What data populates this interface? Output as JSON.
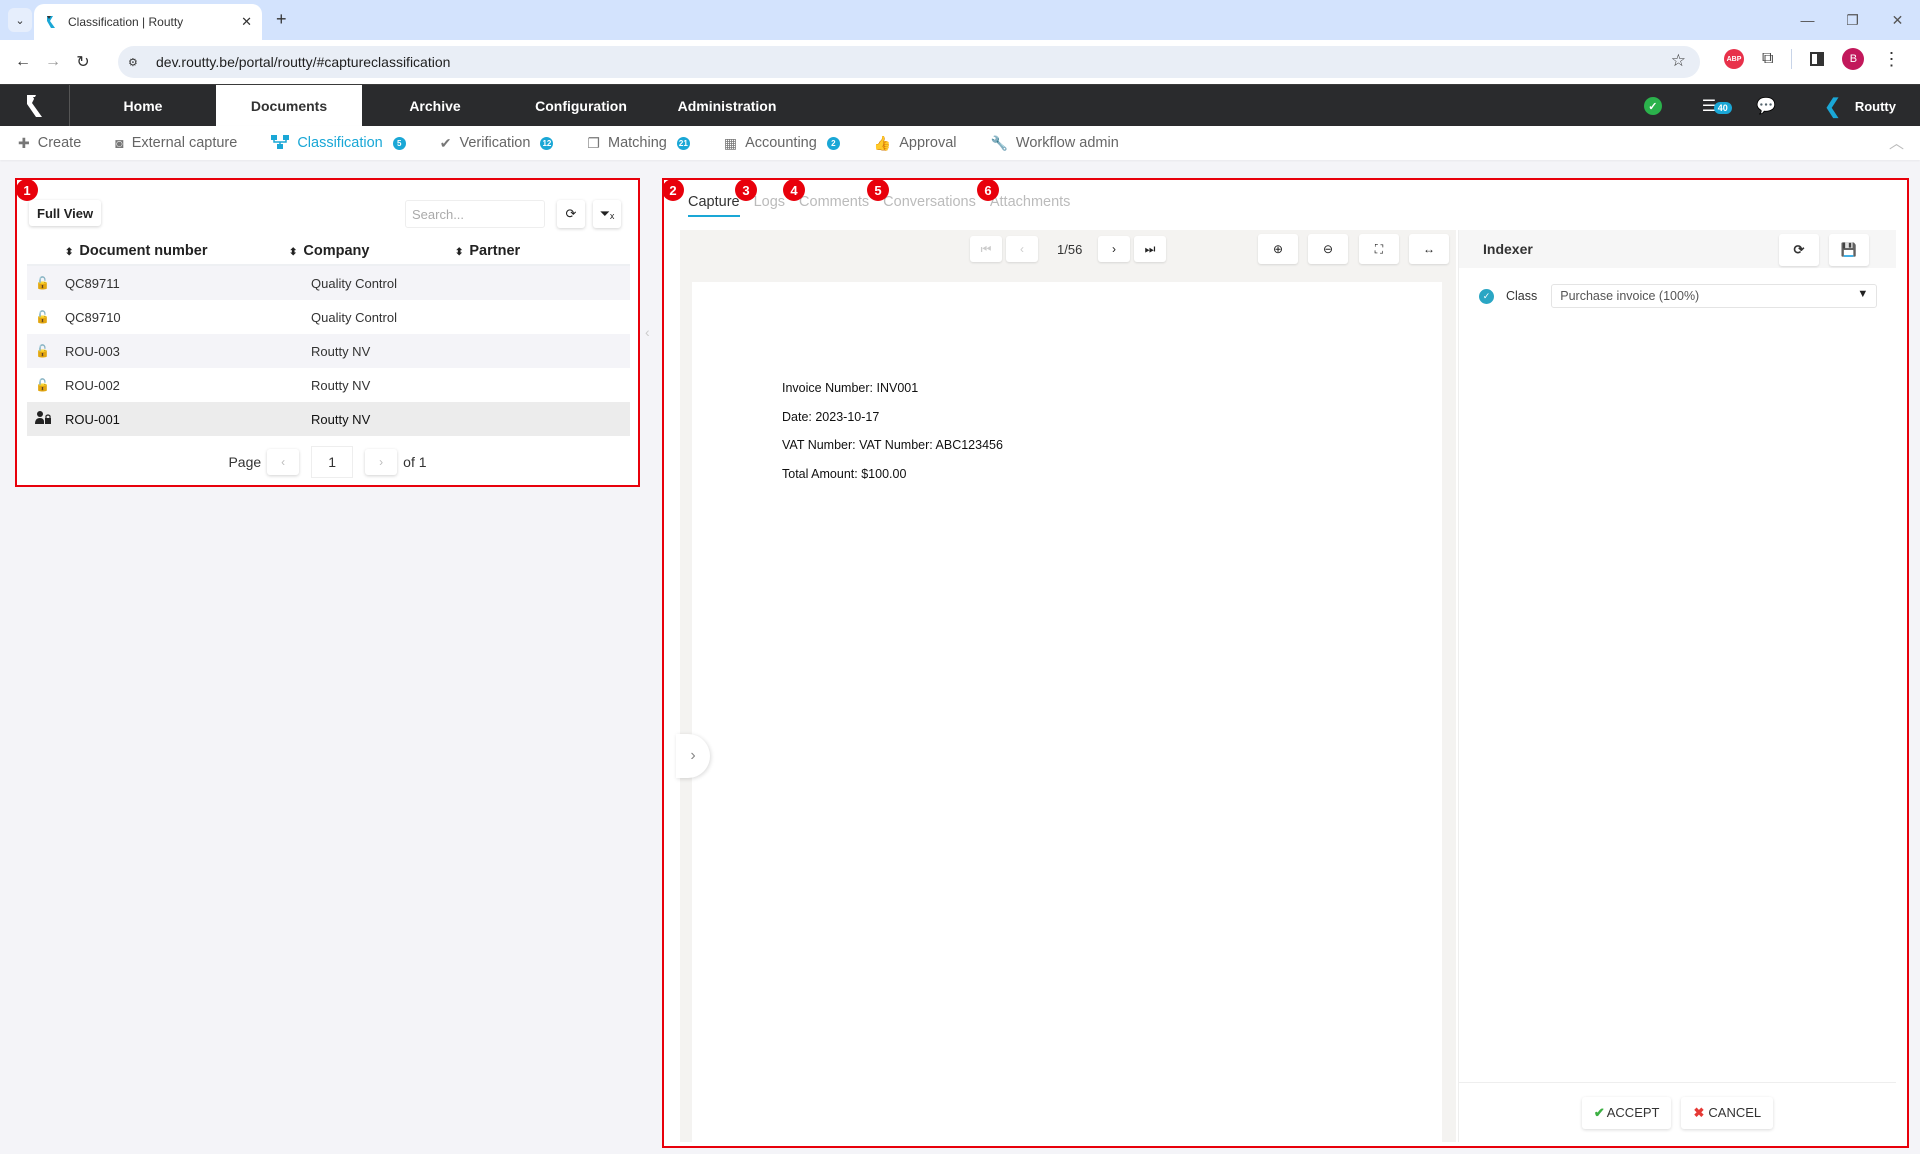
{
  "browser": {
    "tab_title": "Classification | Routty",
    "url": "dev.routty.be/portal/routty/#captureclassification",
    "profile_initial": "B",
    "extension_label": "ABP"
  },
  "app": {
    "main_nav": [
      {
        "label": "Home",
        "active": false
      },
      {
        "label": "Documents",
        "active": true
      },
      {
        "label": "Archive",
        "active": false
      },
      {
        "label": "Configuration",
        "active": false
      },
      {
        "label": "Administration",
        "active": false
      }
    ],
    "tasks_count": "40",
    "user_name": "Routty"
  },
  "sub_nav": [
    {
      "label": "Create",
      "icon": "plus-icon"
    },
    {
      "label": "External capture",
      "icon": "camera-icon"
    },
    {
      "label": "Classification",
      "icon": "sitemap-icon",
      "count": "5",
      "active": true
    },
    {
      "label": "Verification",
      "icon": "check-circle-icon",
      "count": "12"
    },
    {
      "label": "Matching",
      "icon": "copy-icon",
      "count": "21"
    },
    {
      "label": "Accounting",
      "icon": "calculator-icon",
      "count": "2"
    },
    {
      "label": "Approval",
      "icon": "thumbs-up-icon"
    },
    {
      "label": "Workflow admin",
      "icon": "wrench-icon"
    }
  ],
  "markers": [
    "1",
    "2",
    "3",
    "4",
    "5",
    "6"
  ],
  "list": {
    "full_view_label": "Full View",
    "search_placeholder": "Search...",
    "columns": [
      "Document number",
      "Company",
      "Partner"
    ],
    "rows": [
      {
        "doc": "QC89711",
        "company": "Quality Control",
        "partner": "",
        "locked": false
      },
      {
        "doc": "QC89710",
        "company": "Quality Control",
        "partner": "",
        "locked": false
      },
      {
        "doc": "ROU-003",
        "company": "Routty NV",
        "partner": "",
        "locked": false
      },
      {
        "doc": "ROU-002",
        "company": "Routty NV",
        "partner": "",
        "locked": false
      },
      {
        "doc": "ROU-001",
        "company": "Routty NV",
        "partner": "",
        "locked": true,
        "selected": true
      }
    ],
    "pager": {
      "label": "Page",
      "current": "1",
      "of_label": "of 1"
    }
  },
  "detail": {
    "tabs": [
      "Capture",
      "Logs",
      "Comments",
      "Conversations",
      "Attachments"
    ],
    "active_tab": "Capture",
    "viewer": {
      "page_indicator": "1/56",
      "invoice_lines": [
        "Invoice Number: INV001",
        "Date: 2023-10-17",
        "VAT Number: VAT Number: ABC123456",
        "Total Amount: $100.00"
      ]
    },
    "indexer": {
      "title": "Indexer",
      "class_label": "Class",
      "class_value": "Purchase invoice (100%)",
      "accept_label": "ACCEPT",
      "cancel_label": "CANCEL"
    }
  }
}
